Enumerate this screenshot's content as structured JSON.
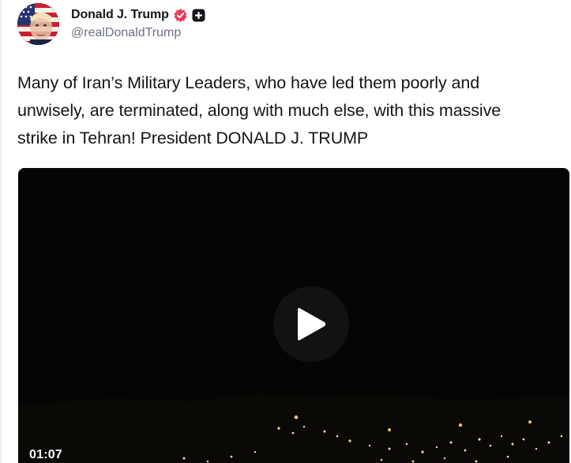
{
  "author": {
    "display_name": "Donald J. Trump",
    "handle": "@realDonaldTrump",
    "avatar_icon": "portrait-flag-avatar",
    "verified_icon": "verified-badge-icon",
    "verified_color": "#e3405c",
    "plus_icon": "plus-badge-icon"
  },
  "post": {
    "lines": [
      "Many of Iran’s Military Leaders, who have led them poorly and",
      "unwisely, are terminated, along with much else, with this massive",
      "strike in Tehran! President DONALD J. TRUMP"
    ]
  },
  "video": {
    "duration": "01:07",
    "play_icon": "play-icon",
    "background_color": "#050505"
  },
  "colors": {
    "text_primary": "#141519",
    "text_secondary": "#6b7280"
  }
}
